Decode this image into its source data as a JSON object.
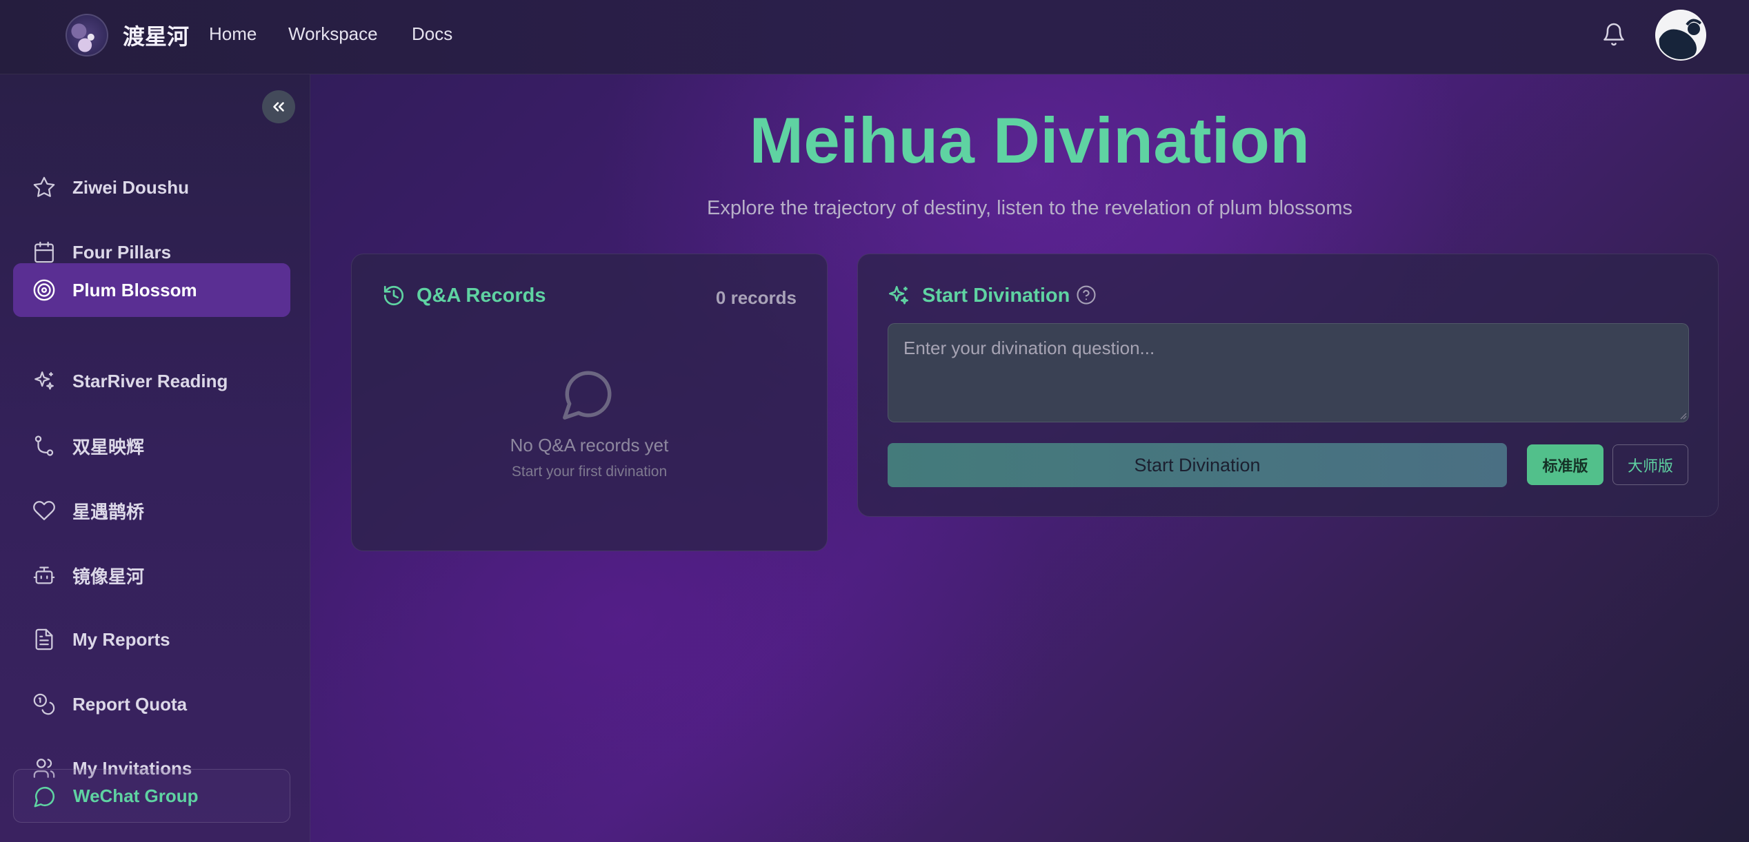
{
  "header": {
    "brand": "渡星河",
    "nav": [
      "Home",
      "Workspace",
      "Docs"
    ]
  },
  "sidebar": {
    "items": [
      {
        "label": "Ziwei Doushu",
        "icon": "star-icon"
      },
      {
        "label": "Four Pillars",
        "icon": "calendar-icon"
      },
      {
        "label": "Plum Blossom",
        "icon": "target-icon",
        "active": true
      },
      {
        "label": "StarRiver Reading",
        "icon": "sparkles-icon"
      },
      {
        "label": "双星映辉",
        "icon": "git-branch-icon"
      },
      {
        "label": "星遇鹊桥",
        "icon": "heart-icon"
      },
      {
        "label": "镜像星河",
        "icon": "bot-icon"
      },
      {
        "label": "My Reports",
        "icon": "file-text-icon"
      },
      {
        "label": "Report Quota",
        "icon": "coins-icon"
      },
      {
        "label": "My Invitations",
        "icon": "users-icon"
      }
    ],
    "wechat": {
      "label": "WeChat Group",
      "icon": "message-circle-icon"
    }
  },
  "main": {
    "title": "Meihua Divination",
    "subtitle": "Explore the trajectory of destiny, listen to the revelation of plum blossoms"
  },
  "qa": {
    "title": "Q&A Records",
    "count": "0 records",
    "empty_title": "No Q&A records yet",
    "empty_sub": "Start your first divination"
  },
  "divination": {
    "title": "Start Divination",
    "placeholder": "Enter your divination question...",
    "value": "",
    "start_label": "Start Divination",
    "standard_label": "标准版",
    "master_label": "大师版"
  },
  "colors": {
    "accent": "#5fd3a2",
    "active_item": "#5a2f93",
    "start_button": "#447b7b",
    "standard_button": "#52c08b"
  }
}
